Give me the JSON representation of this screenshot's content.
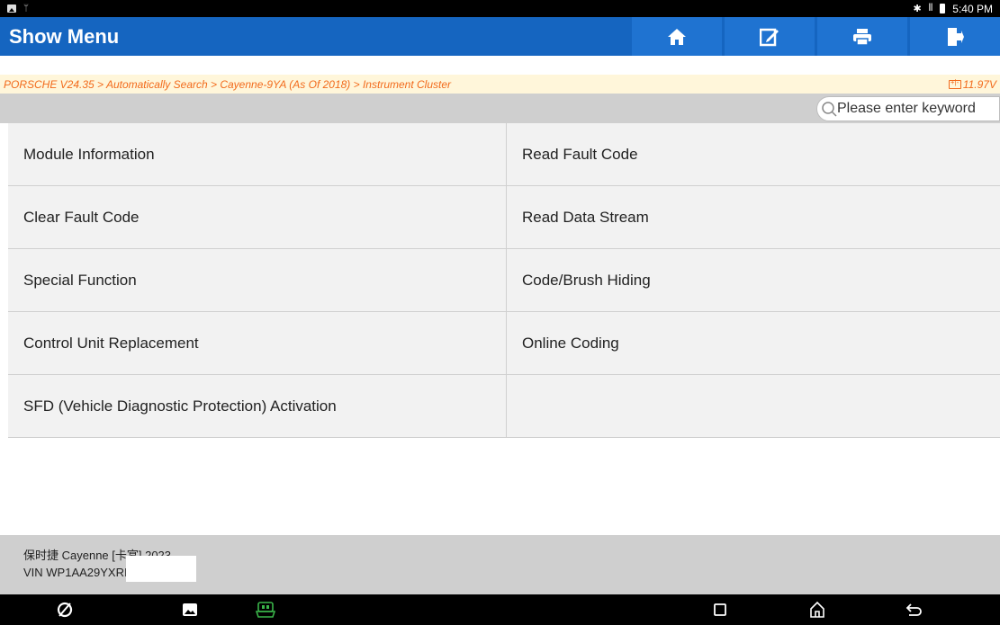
{
  "status_bar": {
    "time": "5:40 PM",
    "left_icons": [
      "image-icon",
      "usb-icon"
    ],
    "right_icons": [
      "bluetooth-icon",
      "vibrate-icon",
      "battery-icon"
    ]
  },
  "header": {
    "title": "Show Menu",
    "buttons": [
      "home-icon",
      "edit-icon",
      "print-icon",
      "exit-icon"
    ],
    "color": "#1565c0"
  },
  "breadcrumb": {
    "path": "PORSCHE V24.35 > Automatically Search > Cayenne-9YA (As Of 2018) > Instrument Cluster",
    "voltage": "11.97V"
  },
  "search": {
    "placeholder": "Please enter keyword"
  },
  "menu": {
    "items": [
      "Module Information",
      "Read Fault Code",
      "Clear Fault Code",
      "Read Data Stream",
      "Special Function",
      "Code/Brush Hiding",
      "Control Unit Replacement",
      "Online Coding",
      "SFD (Vehicle Diagnostic Protection) Activation"
    ]
  },
  "footer": {
    "vehicle": "保时捷 Cayenne [卡宴] 2023",
    "vin": "VIN WP1AA29YXRI"
  },
  "nav_bar": {
    "icons": [
      "browser-icon",
      "gallery-icon",
      "vci-icon",
      "recents-icon",
      "home-icon",
      "back-icon"
    ],
    "accent": "#3ab54a"
  }
}
